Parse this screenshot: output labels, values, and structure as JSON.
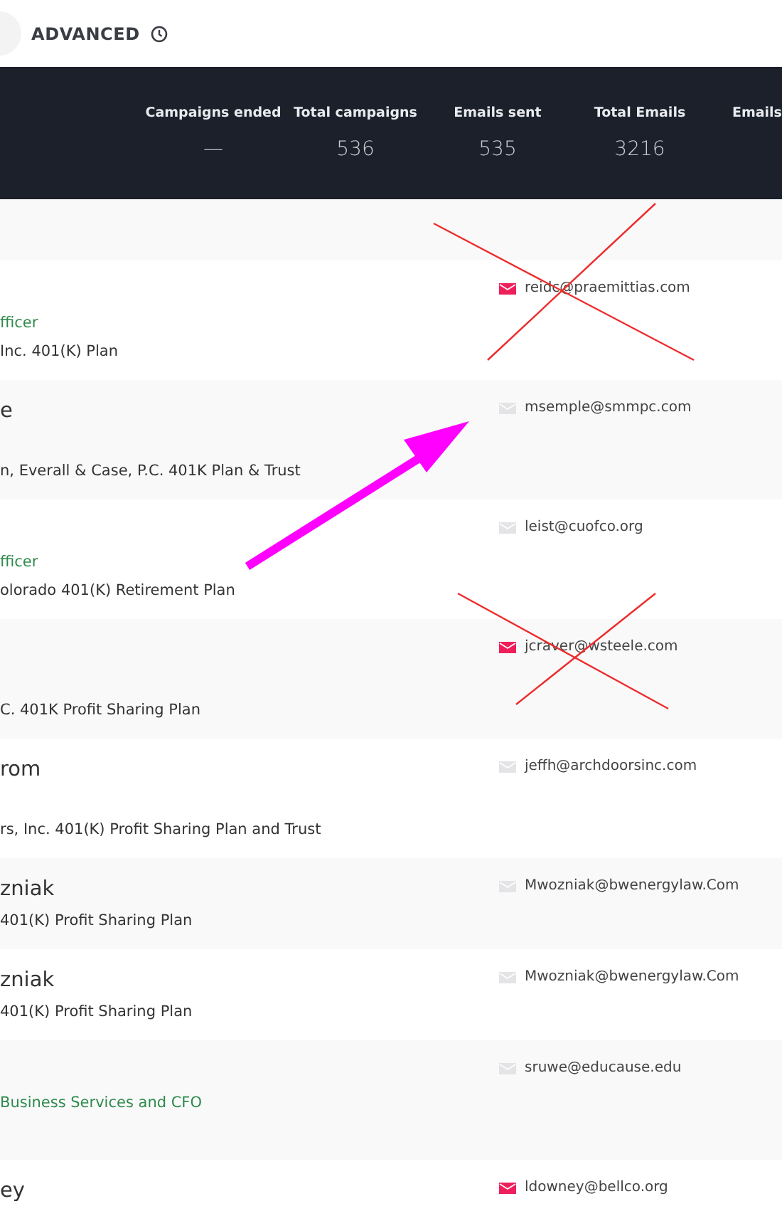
{
  "toolbar": {
    "title": "ADVANCED"
  },
  "stats": [
    {
      "label": "Campaigns ended",
      "value": "—"
    },
    {
      "label": "Total campaigns",
      "value": "536"
    },
    {
      "label": "Emails sent",
      "value": "535"
    },
    {
      "label": "Total Emails",
      "value": "3216"
    },
    {
      "label": "Emails"
    }
  ],
  "annotations": [
    {
      "kind": "cross"
    },
    {
      "kind": "arrow"
    },
    {
      "kind": "cross"
    }
  ],
  "rows": [
    {
      "kind": "full",
      "title": "fficer",
      "plan": "Inc. 401(K) Plan",
      "email": "reidc@praemittias.com",
      "opened": true
    },
    {
      "kind": "full",
      "name": "e",
      "plan": "n, Everall & Case, P.C. 401K Plan & Trust",
      "email": "msemple@smmpc.com",
      "opened": false
    },
    {
      "kind": "full",
      "title": "fficer",
      "plan": "olorado 401(K) Retirement Plan",
      "email": "leist@cuofco.org",
      "opened": false
    },
    {
      "kind": "full",
      "plan": "C. 401K Profit Sharing Plan",
      "email": "jcraver@wsteele.com",
      "opened": true
    },
    {
      "kind": "full",
      "name": "rom",
      "plan": "rs, Inc. 401(K) Profit Sharing Plan and Trust",
      "email": "jeffh@archdoorsinc.com",
      "opened": false
    },
    {
      "kind": "compact",
      "name": "zniak",
      "plan": "401(K) Profit Sharing Plan",
      "email": "Mwozniak@bwenergylaw.Com",
      "opened": false
    },
    {
      "kind": "compact",
      "name": "zniak",
      "plan": "401(K) Profit Sharing Plan",
      "email": "Mwozniak@bwenergylaw.Com",
      "opened": false
    },
    {
      "kind": "full",
      "title": "Business Services and CFO",
      "email": "sruwe@educause.edu",
      "opened": false
    },
    {
      "kind": "full",
      "name": "ey",
      "email": "ldowney@bellco.org",
      "opened": true
    }
  ]
}
